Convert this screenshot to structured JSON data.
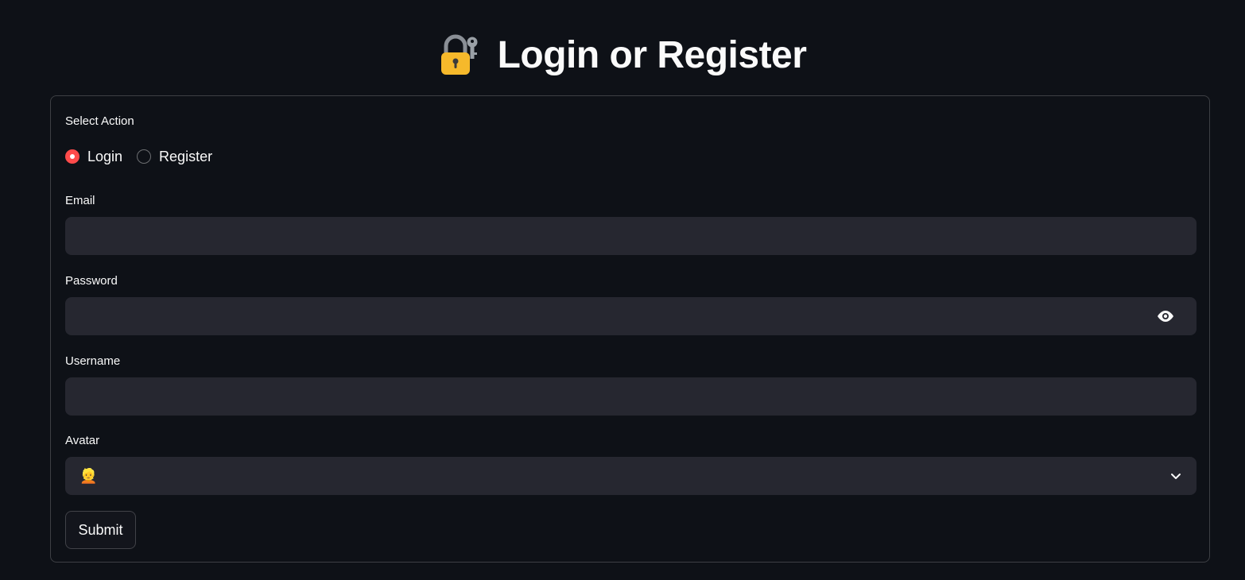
{
  "header": {
    "title": "Login or Register",
    "icon": "lock-with-key-icon"
  },
  "form": {
    "action": {
      "label": "Select Action",
      "options": [
        {
          "label": "Login",
          "selected": true
        },
        {
          "label": "Register",
          "selected": false
        }
      ]
    },
    "email": {
      "label": "Email",
      "value": ""
    },
    "password": {
      "label": "Password",
      "value": "",
      "toggle_icon": "eye-icon"
    },
    "username": {
      "label": "Username",
      "value": ""
    },
    "avatar": {
      "label": "Avatar",
      "value": "👱"
    },
    "submit_label": "Submit"
  },
  "colors": {
    "background": "#0e1117",
    "input_background": "#262730",
    "accent": "#ff4b4b",
    "text": "#fafafa"
  }
}
